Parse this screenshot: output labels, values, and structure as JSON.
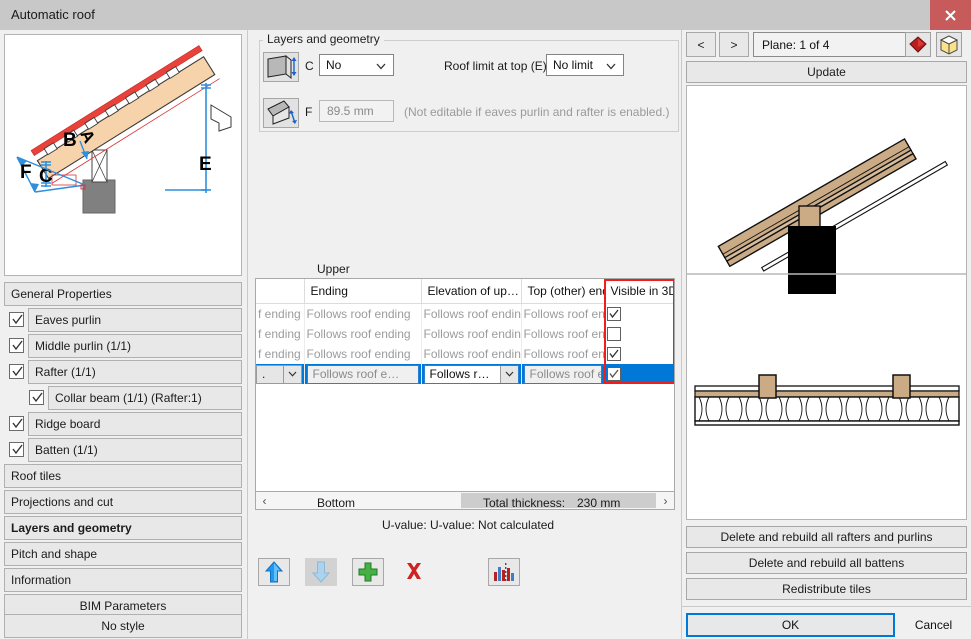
{
  "window": {
    "title": "Automatic roof",
    "close_label": "x"
  },
  "sidebar": {
    "items": [
      {
        "label": "General Properties",
        "indent": 0,
        "checkbox": null,
        "bold": false
      },
      {
        "label": "Eaves purlin",
        "indent": 1,
        "checkbox": true,
        "bold": false
      },
      {
        "label": "Middle purlin (1/1)",
        "indent": 1,
        "checkbox": true,
        "bold": false
      },
      {
        "label": "Rafter (1/1)",
        "indent": 1,
        "checkbox": true,
        "bold": false
      },
      {
        "label": "Collar beam (1/1) (Rafter:1)",
        "indent": 2,
        "checkbox": true,
        "bold": false
      },
      {
        "label": "Ridge board",
        "indent": 1,
        "checkbox": true,
        "bold": false
      },
      {
        "label": "Batten (1/1)",
        "indent": 1,
        "checkbox": true,
        "bold": false
      },
      {
        "label": "Roof tiles",
        "indent": 0,
        "checkbox": null,
        "bold": false
      },
      {
        "label": "Projections and cut",
        "indent": 0,
        "checkbox": null,
        "bold": false
      },
      {
        "label": "Layers and geometry",
        "indent": 0,
        "checkbox": null,
        "bold": true
      },
      {
        "label": "Pitch and shape",
        "indent": 0,
        "checkbox": null,
        "bold": false
      },
      {
        "label": "Information",
        "indent": 0,
        "checkbox": null,
        "bold": false
      }
    ],
    "bim_parameters_label": "BIM Parameters",
    "no_style_label": "No style"
  },
  "geometry_group": {
    "title": "Layers and geometry",
    "row_c": {
      "letter": "C",
      "value": "No"
    },
    "row_f": {
      "letter": "F",
      "value": "89.5 mm",
      "hint": "(Not editable if eaves purlin and rafter is enabled.)"
    },
    "roof_limit": {
      "label": "Roof limit at top (E)",
      "value": "No limit"
    }
  },
  "layer_table": {
    "upper_label": "Upper",
    "bottom_label": "Bottom",
    "columns": [
      "",
      "Ending",
      "Elevation of up…",
      "Top (other) end…",
      "Visible in 3D"
    ],
    "rows": [
      {
        "cells": [
          "f ending",
          "Follows roof ending",
          "Follows roof ending",
          "Follows roof ending"
        ],
        "visible_3d": true,
        "selected": false
      },
      {
        "cells": [
          "f ending",
          "Follows roof ending",
          "Follows roof ending",
          "Follows roof ending"
        ],
        "visible_3d": false,
        "selected": false
      },
      {
        "cells": [
          "f ending",
          "Follows roof ending",
          "Follows roof ending",
          "Follows roof ending"
        ],
        "visible_3d": true,
        "selected": false
      }
    ],
    "editing_row": {
      "col0_value": ".",
      "col1_value": "Follows roof e…",
      "col2_value": "Follows r…",
      "col3_value": "Follows roof e…",
      "visible_3d": true
    },
    "scroll_left_label": "‹",
    "scroll_right_label": "›"
  },
  "summary": {
    "total_thickness_label": "Total thickness:",
    "total_thickness_value": "230 mm",
    "u_value_text": "U-value: U-value: Not calculated"
  },
  "toolbar": {
    "buttons": [
      {
        "name": "move-up",
        "icon": "arrow-up-icon",
        "enabled": true
      },
      {
        "name": "move-down",
        "icon": "arrow-down-icon",
        "enabled": false
      },
      {
        "name": "add-layer",
        "icon": "plus-icon",
        "enabled": true
      },
      {
        "name": "delete-layer",
        "icon": "delete-x-icon",
        "enabled": true
      },
      {
        "name": "layer-chart",
        "icon": "bar-chart-icon",
        "enabled": true
      }
    ]
  },
  "right_panel": {
    "prev_label": "<",
    "next_label": ">",
    "plane_value": "Plane: 1 of 4",
    "update_label": "Update",
    "action_buttons": [
      "Delete and rebuild all rafters and purlins",
      "Delete and rebuild all battens",
      "Redistribute tiles"
    ],
    "ok_label": "OK",
    "cancel_label": "Cancel"
  },
  "diagram_labels": {
    "b": "B",
    "c": "C",
    "e": "E",
    "f": "F"
  },
  "colors": {
    "accent": "#0078d7",
    "highlight_box": "#f01d1d",
    "close_button": "#c75b5b",
    "wood": "#f5d0a9",
    "roof_red": "#e8423a"
  }
}
